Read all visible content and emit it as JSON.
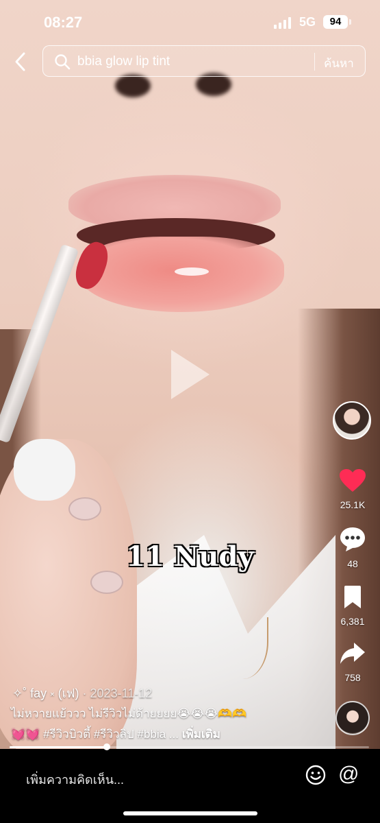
{
  "status_bar": {
    "time": "08:27",
    "network": "5G",
    "battery": "94"
  },
  "search": {
    "query": "bbia glow lip tint",
    "button_label": "ค้นหา"
  },
  "video": {
    "overlay_text": "11 Nudy",
    "progress_fraction": 0.27
  },
  "actions": {
    "likes": "25.1K",
    "comments": "48",
    "bookmarks": "6,381",
    "shares": "758",
    "like_color": "#fe2c55"
  },
  "post": {
    "author": "✧˚ fay ༝ (เฟ)",
    "separator": "·",
    "date": "2023-11-12",
    "caption_line1": "ไม่หวายแย้ววว ไม่รีวิวไม่ด้ายยยย",
    "caption_line1_emoji": "😭😭😭🫶🫶",
    "caption_line2_emoji": "💓💓",
    "hashtags": "#รีวิวบิวตี้ #รีวิวลิป #bbia ...",
    "more_label": "เพิ่มเติม"
  },
  "comment_bar": {
    "placeholder": "เพิ่มความคิดเห็น...",
    "emoji_icon": "smiley-icon",
    "mention_icon": "at-icon",
    "mention_glyph": "@"
  }
}
